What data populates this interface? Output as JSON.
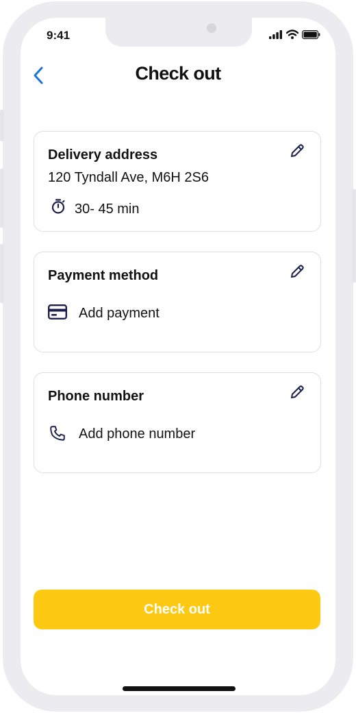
{
  "status_bar": {
    "time": "9:41"
  },
  "header": {
    "title": "Check out"
  },
  "delivery": {
    "title": "Delivery address",
    "address": "120 Tyndall Ave, M6H 2S6",
    "eta": "30- 45 min"
  },
  "payment": {
    "title": "Payment method",
    "action": "Add payment"
  },
  "phone": {
    "title": "Phone number",
    "action": "Add phone number"
  },
  "footer": {
    "checkout_label": "Check out"
  },
  "colors": {
    "accent": "#fdc913",
    "back_arrow": "#1a73d9",
    "icon_navy": "#1c1f4a"
  }
}
